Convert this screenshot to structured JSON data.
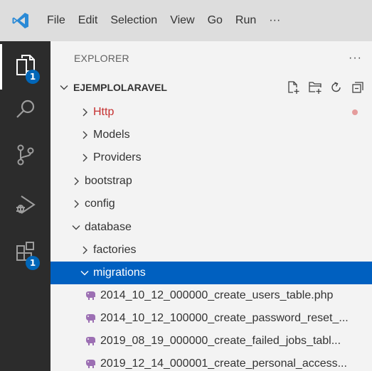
{
  "menu": {
    "items": [
      "File",
      "Edit",
      "Selection",
      "View",
      "Go",
      "Run"
    ],
    "more": "···"
  },
  "activity": {
    "explorer_badge": "1",
    "extensions_badge": "1"
  },
  "sidebar": {
    "title": "EXPLORER",
    "more": "···",
    "section_title": "EJEMPLOLARAVEL"
  },
  "tree": {
    "http": "Http",
    "models": "Models",
    "providers": "Providers",
    "bootstrap": "bootstrap",
    "config": "config",
    "database": "database",
    "factories": "factories",
    "migrations": "migrations",
    "files": [
      "2014_10_12_000000_create_users_table.php",
      "2014_10_12_100000_create_password_reset_...",
      "2019_08_19_000000_create_failed_jobs_tabl...",
      "2019_12_14_000001_create_personal_access..."
    ]
  },
  "colors": {
    "accent": "#0060c0",
    "badge": "#0066b8",
    "modified": "#c53030",
    "php": "#9c6fb3"
  }
}
